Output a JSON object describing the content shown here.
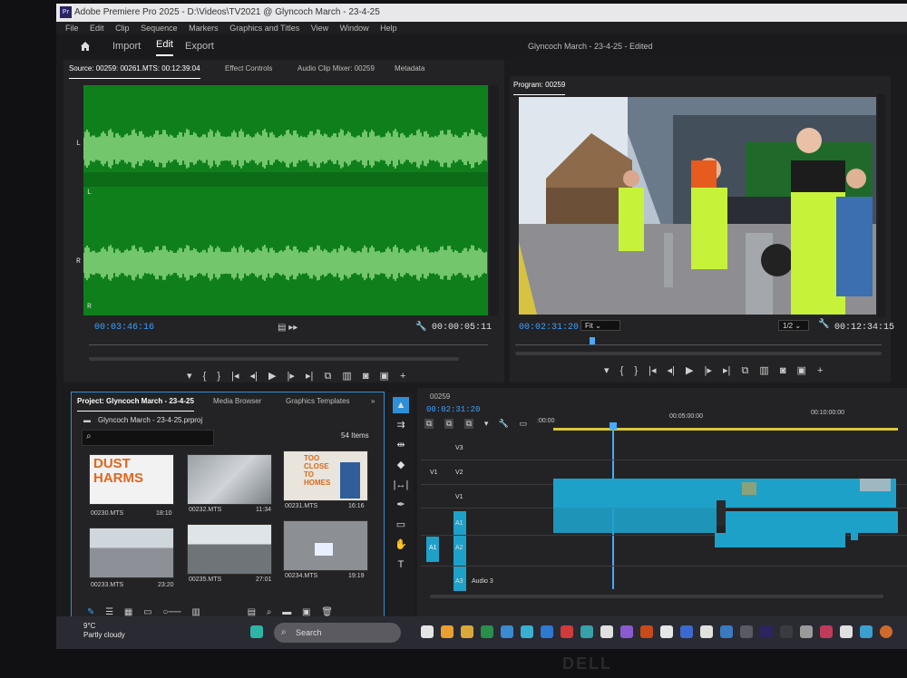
{
  "window": {
    "title": "Adobe Premiere Pro 2025 - D:\\Videos\\TV2021 @ Glyncoch March - 23-4-25"
  },
  "menu": [
    "File",
    "Edit",
    "Clip",
    "Sequence",
    "Markers",
    "Graphics and Titles",
    "View",
    "Window",
    "Help"
  ],
  "workspace": {
    "tabs": [
      "Import",
      "Edit",
      "Export"
    ],
    "active": "Edit",
    "sequence_title": "Glyncoch March - 23-4-25 - Edited"
  },
  "source_panel": {
    "tabs": [
      "Source: 00259: 00261.MTS: 00:12:39:04",
      "Effect Controls",
      "Audio Clip Mixer: 00259",
      "Metadata"
    ],
    "timecode_in": "00:03:46:16",
    "duration": "00:00:05:11",
    "channel_labels": [
      "L",
      "L",
      "R",
      "R"
    ]
  },
  "program_panel": {
    "tab": "Program: 00259",
    "timecode": "00:02:31:20",
    "fit": "Fit",
    "resolution": "1/2",
    "duration": "00:12:34:15"
  },
  "project_panel": {
    "tabs": [
      "Project: Glyncoch March - 23-4-25",
      "Media Browser",
      "Graphics Templates"
    ],
    "project_file": "Glyncoch March - 23-4-25.prproj",
    "item_count": "54 Items",
    "search_placeholder": "",
    "items": [
      {
        "name": "00230.MTS",
        "duration": "18:10",
        "art": "DUST HARMS"
      },
      {
        "name": "00232.MTS",
        "duration": "11:34",
        "art": ""
      },
      {
        "name": "00231.MTS",
        "duration": "16:16",
        "art": "TOO CLOSE TO HOMES"
      },
      {
        "name": "00233.MTS",
        "duration": "23:20",
        "art": ""
      },
      {
        "name": "00235.MTS",
        "duration": "27:01",
        "art": ""
      },
      {
        "name": "00234.MTS",
        "duration": "19:19",
        "art": ""
      }
    ]
  },
  "timeline": {
    "tab": "00259",
    "timecode": "00:02:31:20",
    "ruler": [
      ":00:00",
      "00:05:00:00",
      "00:10:00:00"
    ],
    "tracks": [
      "V3",
      "V2",
      "V1",
      "A1",
      "A2",
      "A3"
    ],
    "audio3_label": "Audio 3",
    "sync_labels": [
      "V1",
      "A1"
    ]
  },
  "taskbar": {
    "weather_temp": "9°C",
    "weather_desc": "Partly cloudy",
    "search_label": "Search"
  },
  "monitor_brand": "DELL",
  "colors": {
    "waveform_bg": "#0f7f1c",
    "waveform_line": "#b6f5a0",
    "accent_blue": "#3aa0ff",
    "clip_blue": "#1ea1c9",
    "playhead": "#4aa8ff"
  }
}
